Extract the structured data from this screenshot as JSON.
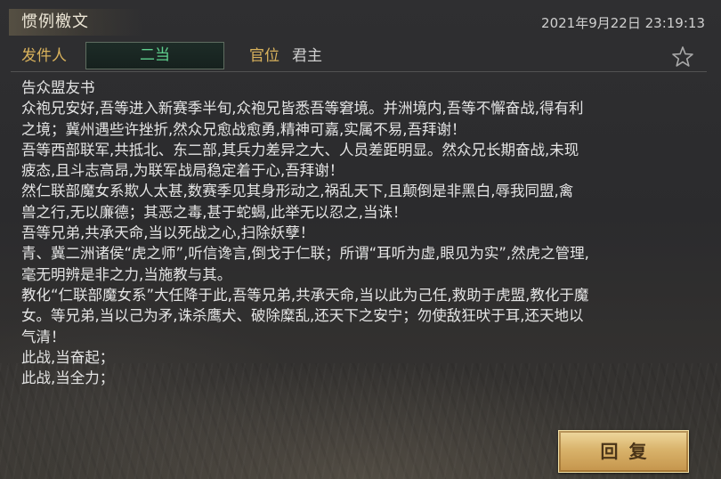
{
  "header": {
    "title": "惯例檄文",
    "datetime": "2021年9月22日 23:19:13"
  },
  "sender": {
    "label": "发件人",
    "name": "二当",
    "rank_label": "官位",
    "rank_value": "君主"
  },
  "icons": {
    "favorite": "star-outline-icon"
  },
  "body": {
    "lines": [
      "告众盟友书",
      "众袍兄安好,吾等进入新赛季半旬,众袍兄皆悉吾等窘境。并洲境内,吾等不懈奋战,得有利",
      "之境；冀州遇些许挫折,然众兄愈战愈勇,精神可嘉,实属不易,吾拜谢！",
      "吾等西部联军,共抵北、东二部,其兵力差异之大、人员差距明显。然众兄长期奋战,未现",
      "疲态,且斗志高昂,为联军战局稳定着于心,吾拜谢！",
      "然仁联部魔女系欺人太甚,数赛季见其身形动之,祸乱天下,且颠倒是非黑白,辱我同盟,禽",
      "兽之行,无以廉德；其恶之毒,甚于蛇蝎,此举无以忍之,当诛！",
      "吾等兄弟,共承天命,当以死战之心,扫除妖孽！",
      "青、冀二洲诸侯“虎之师”,听信谗言,倒戈于仁联；所谓“耳听为虚,眼见为实”,然虎之管理,",
      "毫无明辨是非之力,当施教与其。",
      "教化“仁联部魔女系”大任降于此,吾等兄弟,共承天命,当以此为己任,救助于虎盟,教化于魔",
      "女。等兄弟,当以己为矛,诛杀鹰犬、破除糜乱,还天下之安宁；勿使敌狂吠于耳,还天地以",
      "气清！",
      "此战,当奋起；",
      "此战,当全力；"
    ]
  },
  "actions": {
    "reply_label": "回复"
  },
  "colors": {
    "sender_name": "#5fd08e",
    "label_gold": "#d9b25c",
    "button_gold": "#d9b36b"
  }
}
